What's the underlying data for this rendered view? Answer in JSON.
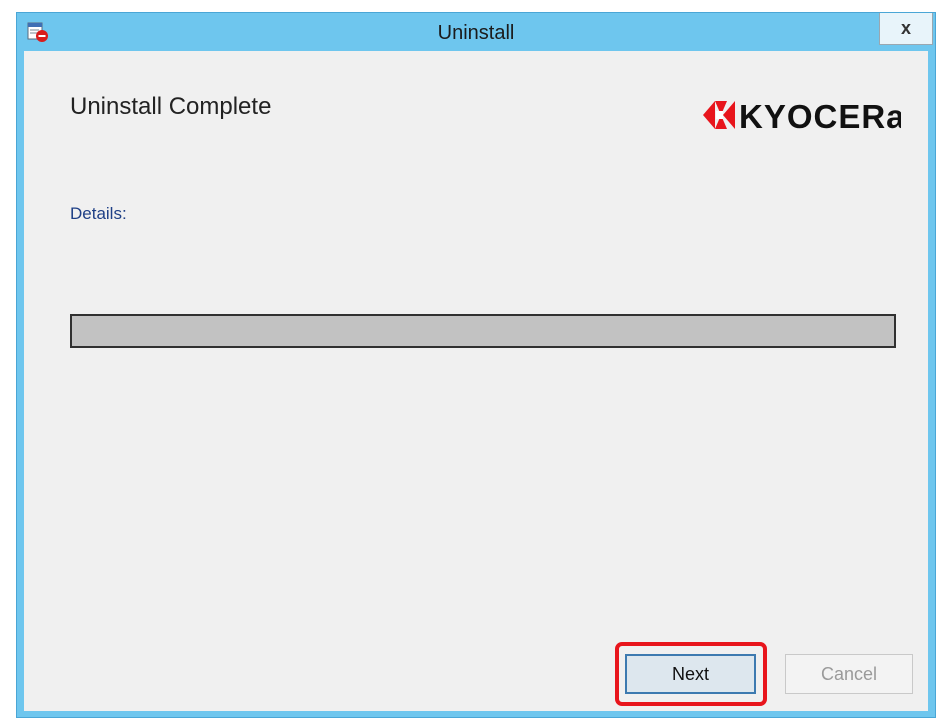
{
  "window": {
    "title": "Uninstall",
    "close_label": "x"
  },
  "content": {
    "heading": "Uninstall Complete",
    "details_label": "Details:",
    "progress_fraction": 1.0
  },
  "logo": {
    "text": "KYOCERa",
    "icon": "kyocera-logo-mark",
    "color": "#e8151c"
  },
  "buttons": {
    "next_label": "Next",
    "cancel_label": "Cancel",
    "cancel_enabled": false
  },
  "colors": {
    "titlebar": "#6ec6ee",
    "client": "#f0f0f0",
    "accent": "#e8151c",
    "details_text": "#1e3f86"
  },
  "icons": {
    "app": "uninstall-app-icon",
    "close": "close-icon"
  }
}
